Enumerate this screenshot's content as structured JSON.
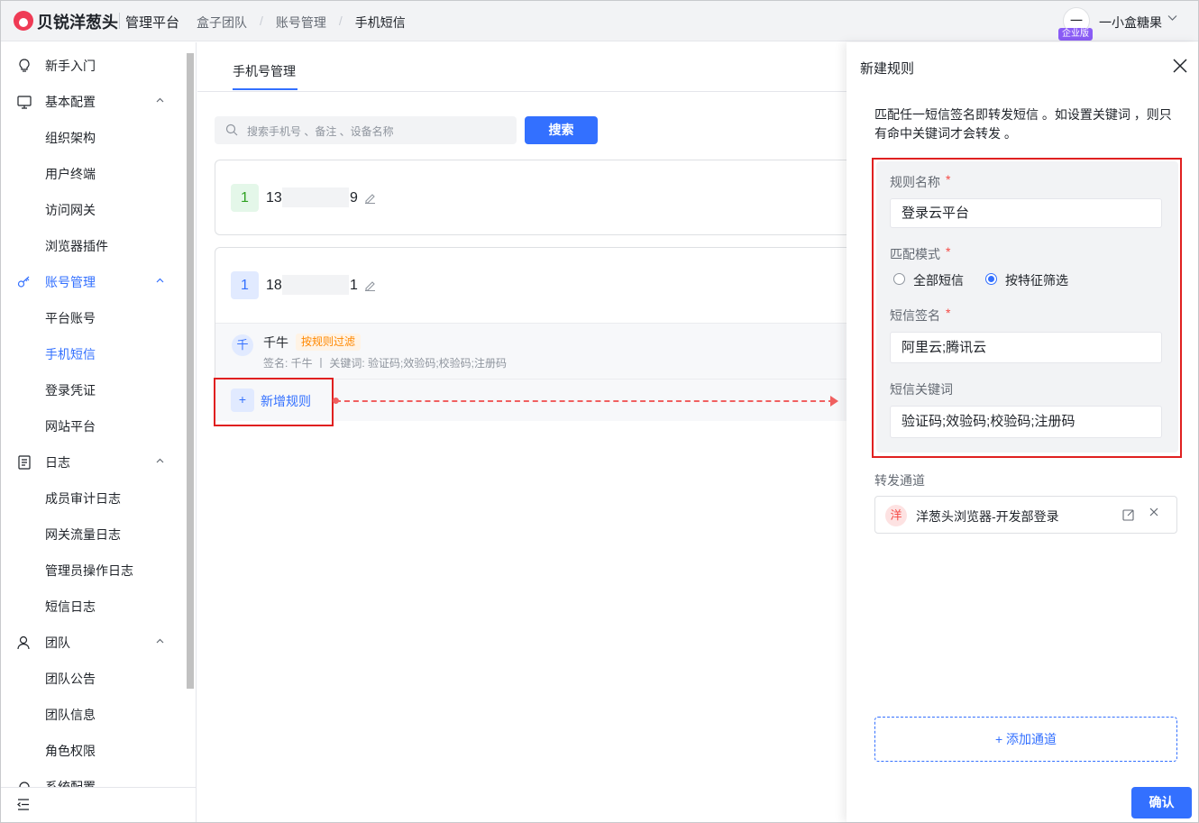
{
  "header": {
    "brand": "贝锐洋葱头",
    "platform": "管理平台",
    "breadcrumbs": [
      "盒子团队",
      "账号管理",
      "手机短信"
    ],
    "user": {
      "avatar_char": "一",
      "badge": "企业版",
      "name": "一小盒糖果"
    }
  },
  "sidebar": {
    "items": [
      {
        "label": "新手入门",
        "icon": "bulb-icon"
      },
      {
        "label": "基本配置",
        "icon": "monitor-icon"
      },
      {
        "label": "组织架构"
      },
      {
        "label": "用户终端"
      },
      {
        "label": "访问网关"
      },
      {
        "label": "浏览器插件"
      },
      {
        "label": "账号管理",
        "icon": "key-icon"
      },
      {
        "label": "平台账号"
      },
      {
        "label": "手机短信"
      },
      {
        "label": "登录凭证"
      },
      {
        "label": "网站平台"
      },
      {
        "label": "日志",
        "icon": "log-icon"
      },
      {
        "label": "成员审计日志"
      },
      {
        "label": "网关流量日志"
      },
      {
        "label": "管理员操作日志"
      },
      {
        "label": "短信日志"
      },
      {
        "label": "团队",
        "icon": "team-icon"
      },
      {
        "label": "团队公告"
      },
      {
        "label": "团队信息"
      },
      {
        "label": "角色权限"
      },
      {
        "label": "系统配置",
        "icon": "settings-icon"
      }
    ],
    "active_color": "#3370ff"
  },
  "main": {
    "tab": "手机号管理",
    "search_placeholder": "搜索手机号 、备注 、设备名称",
    "search_button": "搜索",
    "phones": [
      {
        "badge": "1",
        "prefix": "13",
        "suffix": "9"
      },
      {
        "badge": "1",
        "prefix": "18",
        "suffix": "1"
      }
    ],
    "rule": {
      "avatar": "千",
      "name": "千牛",
      "tag": "按规则过滤",
      "desc": "签名: 千牛 丨 关键词: 验证码;效验码;校验码;注册码"
    },
    "add_rule": {
      "plus": "+",
      "label": "新增规则"
    }
  },
  "drawer": {
    "title": "新建规则",
    "description": "匹配任一短信签名即转发短信 。如设置关键词 ，则只有命中关键词才会转发 。",
    "fields": {
      "rule_name_label": "规则名称",
      "rule_name_value": "登录云平台",
      "match_mode_label": "匹配模式",
      "match_all": "全部短信",
      "match_feature": "按特征筛选",
      "signature_label": "短信签名",
      "signature_value": "阿里云;腾讯云",
      "keyword_label": "短信关键词",
      "keyword_value": "验证码;效验码;校验码;注册码",
      "required_mark": "*"
    },
    "forward_label": "转发通道",
    "channel": {
      "avatar": "洋",
      "name": "洋葱头浏览器-开发部登录"
    },
    "add_channel": "+ 添加通道",
    "confirm": "确认"
  }
}
